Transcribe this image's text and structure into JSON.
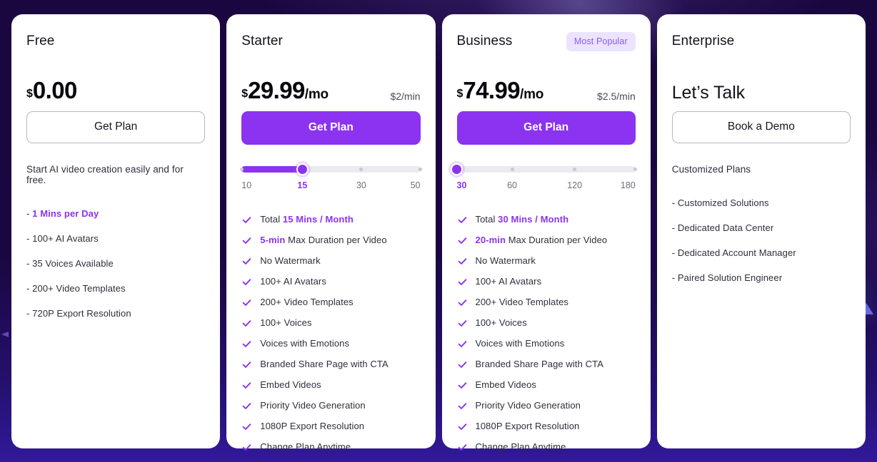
{
  "theme": {
    "accent": "#8b33f0",
    "badge_bg": "#ece3fe",
    "card_bg": "#ffffff",
    "page_bg": "#1a0741",
    "text": "#2f2e3c"
  },
  "plans": [
    {
      "name": "Free",
      "badge": null,
      "price": {
        "currency": "$",
        "amount": "0.00",
        "period": "",
        "per_min": ""
      },
      "cta": {
        "label": "Get Plan",
        "style": "outline"
      },
      "slider": null,
      "intro": "Start AI video creation easily and for free.",
      "list_style": "dash",
      "features": [
        {
          "dash": "-",
          "highlight": "1 Mins per Day",
          "text": ""
        },
        {
          "dash": "-",
          "highlight": "",
          "text": "100+ AI Avatars"
        },
        {
          "dash": "-",
          "highlight": "",
          "text": "35 Voices Available"
        },
        {
          "dash": "-",
          "highlight": "",
          "text": "200+ Video Templates"
        },
        {
          "dash": "-",
          "highlight": "",
          "text": "720P Export Resolution"
        }
      ]
    },
    {
      "name": "Starter",
      "badge": null,
      "price": {
        "currency": "$",
        "amount": "29.99",
        "period": "/mo",
        "per_min": "$2/min"
      },
      "cta": {
        "label": "Get Plan",
        "style": "solid"
      },
      "slider": {
        "ticks": [
          "10",
          "15",
          "30",
          "50"
        ],
        "tick_positions": [
          0,
          34,
          67,
          100
        ],
        "selected_index": 1,
        "selected_value": "15",
        "fill_percent": 34
      },
      "intro": null,
      "list_style": "check",
      "features": [
        {
          "text": "Total ",
          "highlight": "15 Mins / Month",
          "after": ""
        },
        {
          "text": "",
          "highlight": "5-min",
          "after": " Max Duration per Video"
        },
        {
          "text": "No Watermark",
          "highlight": "",
          "after": ""
        },
        {
          "text": "100+ AI Avatars",
          "highlight": "",
          "after": ""
        },
        {
          "text": "200+ Video Templates",
          "highlight": "",
          "after": ""
        },
        {
          "text": "100+ Voices",
          "highlight": "",
          "after": ""
        },
        {
          "text": "Voices with Emotions",
          "highlight": "",
          "after": ""
        },
        {
          "text": "Branded Share Page with CTA",
          "highlight": "",
          "after": ""
        },
        {
          "text": "Embed Videos",
          "highlight": "",
          "after": ""
        },
        {
          "text": "Priority Video Generation",
          "highlight": "",
          "after": ""
        },
        {
          "text": "1080P Export Resolution",
          "highlight": "",
          "after": ""
        },
        {
          "text": "Change Plan Anytime",
          "highlight": "",
          "after": ""
        }
      ]
    },
    {
      "name": "Business",
      "badge": "Most Popular",
      "price": {
        "currency": "$",
        "amount": "74.99",
        "period": "/mo",
        "per_min": "$2.5/min"
      },
      "cta": {
        "label": "Get Plan",
        "style": "solid"
      },
      "slider": {
        "ticks": [
          "30",
          "60",
          "120",
          "180"
        ],
        "tick_positions": [
          0,
          31,
          66,
          100
        ],
        "selected_index": 0,
        "selected_value": "30",
        "fill_percent": 0
      },
      "intro": null,
      "list_style": "check",
      "features": [
        {
          "text": "Total ",
          "highlight": "30 Mins / Month",
          "after": ""
        },
        {
          "text": "",
          "highlight": "20-min",
          "after": " Max Duration per Video"
        },
        {
          "text": "No Watermark",
          "highlight": "",
          "after": ""
        },
        {
          "text": "100+ AI Avatars",
          "highlight": "",
          "after": ""
        },
        {
          "text": "200+ Video Templates",
          "highlight": "",
          "after": ""
        },
        {
          "text": "100+ Voices",
          "highlight": "",
          "after": ""
        },
        {
          "text": "Voices with Emotions",
          "highlight": "",
          "after": ""
        },
        {
          "text": "Branded Share Page with CTA",
          "highlight": "",
          "after": ""
        },
        {
          "text": "Embed Videos",
          "highlight": "",
          "after": ""
        },
        {
          "text": "Priority Video Generation",
          "highlight": "",
          "after": ""
        },
        {
          "text": "1080P Export Resolution",
          "highlight": "",
          "after": ""
        },
        {
          "text": "Change Plan Anytime",
          "highlight": "",
          "after": ""
        }
      ]
    },
    {
      "name": "Enterprise",
      "badge": null,
      "price": {
        "currency": "",
        "amount": "",
        "period": "",
        "per_min": "",
        "text": "Let’s Talk"
      },
      "cta": {
        "label": "Book a Demo",
        "style": "outline"
      },
      "slider": null,
      "intro": "Customized Plans",
      "list_style": "dash",
      "features": [
        {
          "dash": "-",
          "highlight": "",
          "text": "Customized Solutions"
        },
        {
          "dash": "-",
          "highlight": "",
          "text": "Dedicated Data Center"
        },
        {
          "dash": "-",
          "highlight": "",
          "text": "Dedicated Account Manager"
        },
        {
          "dash": "-",
          "highlight": "",
          "text": "Paired Solution Engineer"
        }
      ]
    }
  ],
  "icons": {
    "check": "check-icon",
    "slider_thumb": "slider-thumb"
  }
}
